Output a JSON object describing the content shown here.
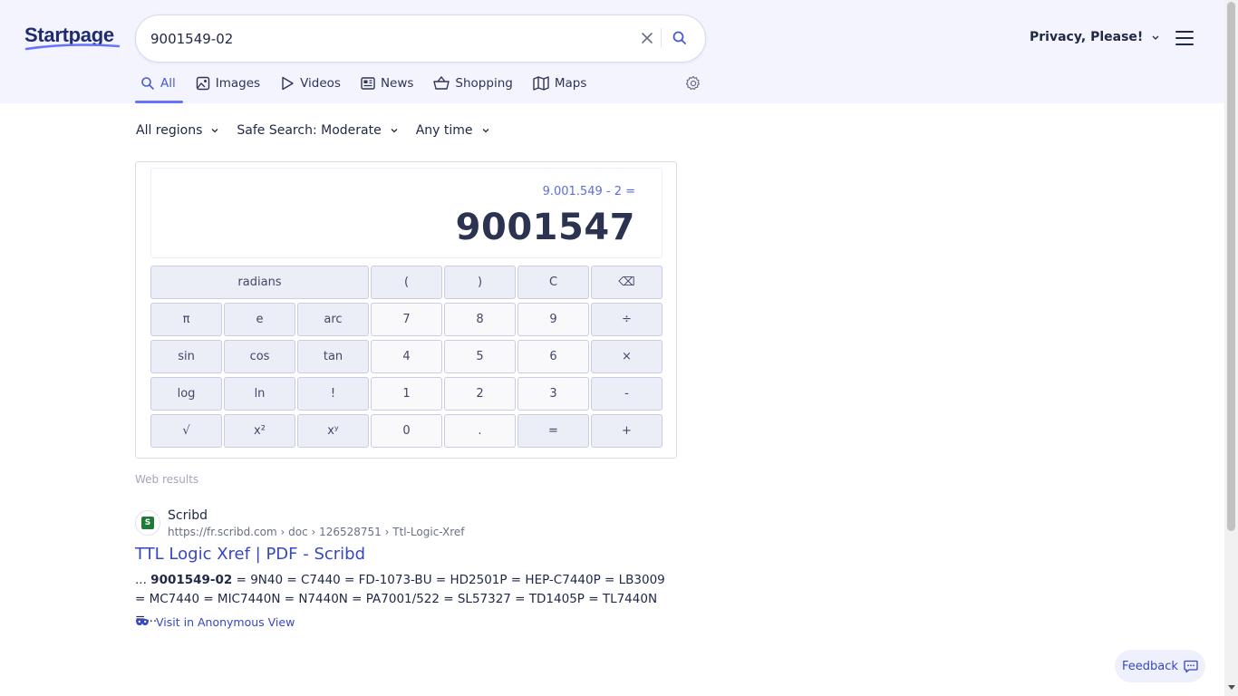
{
  "header": {
    "logo": "Startpage",
    "search_query": "9001549-02",
    "privacy_label": "Privacy, Please!"
  },
  "tabs": [
    {
      "label": "All",
      "icon": "search-icon",
      "active": true
    },
    {
      "label": "Images",
      "icon": "image-icon"
    },
    {
      "label": "Videos",
      "icon": "play-icon"
    },
    {
      "label": "News",
      "icon": "news-icon"
    },
    {
      "label": "Shopping",
      "icon": "basket-icon"
    },
    {
      "label": "Maps",
      "icon": "map-icon"
    }
  ],
  "filters": {
    "region": "All regions",
    "safe_search": "Safe Search: Moderate",
    "time": "Any time"
  },
  "calculator": {
    "expression": "9.001.549 - 2 =",
    "result": "9001547",
    "keys": [
      "radians",
      "(",
      ")",
      "C",
      "⌫",
      "π",
      "e",
      "arc",
      "7",
      "8",
      "9",
      "÷",
      "sin",
      "cos",
      "tan",
      "4",
      "5",
      "6",
      "×",
      "log",
      "ln",
      "!",
      "1",
      "2",
      "3",
      "-",
      "√",
      "x²",
      "xʸ",
      "0",
      ".",
      "=",
      "+"
    ]
  },
  "web_results_label": "Web results",
  "result": {
    "favicon_text": "S",
    "site_name": "Scribd",
    "url": "https://fr.scribd.com › doc › 126528751 › Ttl-Logic-Xref",
    "title": "TTL Logic Xref | PDF - Scribd",
    "snippet_prefix": "... ",
    "snippet_bold": "9001549-02",
    "snippet_rest": " = 9N40 = C7440 = FD-1073-BU = HD2501P = HEP-C7440P = LB3009 = MC7440 = MIC7440N = N7440N = PA7001/522 = SL57327 = TD1405P = TL7440N =...",
    "anon_link": "Visit in Anonymous View"
  },
  "feedback_label": "Feedback",
  "colors": {
    "accent": "#6573ff",
    "link": "#3647c4",
    "header_bg": "#f3f4fe"
  }
}
